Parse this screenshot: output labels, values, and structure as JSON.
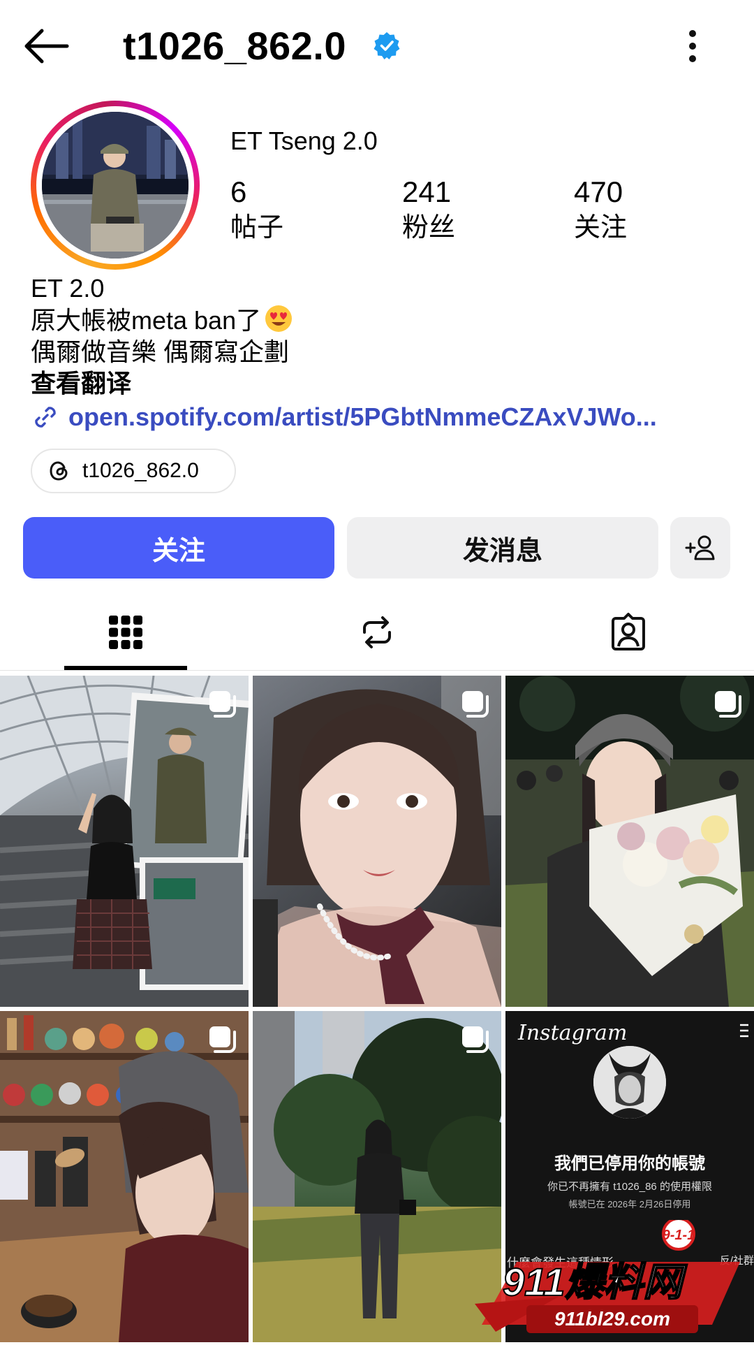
{
  "header": {
    "username": "t1026_862.0"
  },
  "profile": {
    "display_name": "ET Tseng 2.0",
    "stats": [
      {
        "value": "6",
        "label": "帖子"
      },
      {
        "value": "241",
        "label": "粉丝"
      },
      {
        "value": "470",
        "label": "关注"
      }
    ],
    "bio_lines": [
      "ET 2.0",
      "原大帳被meta ban了",
      "偶爾做音樂 偶爾寫企劃"
    ],
    "see_translation": "查看翻译",
    "link": "open.spotify.com/artist/5PGbtNmmeCZAxVJWo...",
    "threads_handle": "t1026_862.0"
  },
  "actions": {
    "follow_label": "关注",
    "message_label": "发消息"
  },
  "tabs": [
    "posts-grid",
    "reposts",
    "tagged"
  ],
  "posts": [
    {
      "multi": true
    },
    {
      "multi": true
    },
    {
      "multi": true
    },
    {
      "multi": true
    },
    {
      "multi": true
    },
    {
      "multi": false,
      "screenshot_brand": "Instagram",
      "screenshot_title": "我們已停用你的帳號",
      "screenshot_line1": "你已不再擁有 t1026_86 的使用權限",
      "screenshot_line2": "帳號已在 2026年 2月26日停用",
      "screenshot_question": "什麼會發生這種情形",
      "screenshot_cut": "反/社群"
    }
  ],
  "watermark": {
    "badge": "9-1-1",
    "title": "911爆料网",
    "url": "911bl29.com"
  },
  "colors": {
    "follow_button": "#4a5df9",
    "link": "#3a4cc0",
    "verified_badge": "#1d9bf0",
    "secondary_button": "#efeff0",
    "watermark_red": "#d81e1e"
  },
  "icons": [
    "back-arrow-icon",
    "verified-badge-icon",
    "more-options-icon",
    "link-icon",
    "threads-icon",
    "add-person-icon",
    "grid-icon",
    "repost-icon",
    "tagged-icon",
    "multi-post-icon",
    "heart-eyes-emoji"
  ]
}
